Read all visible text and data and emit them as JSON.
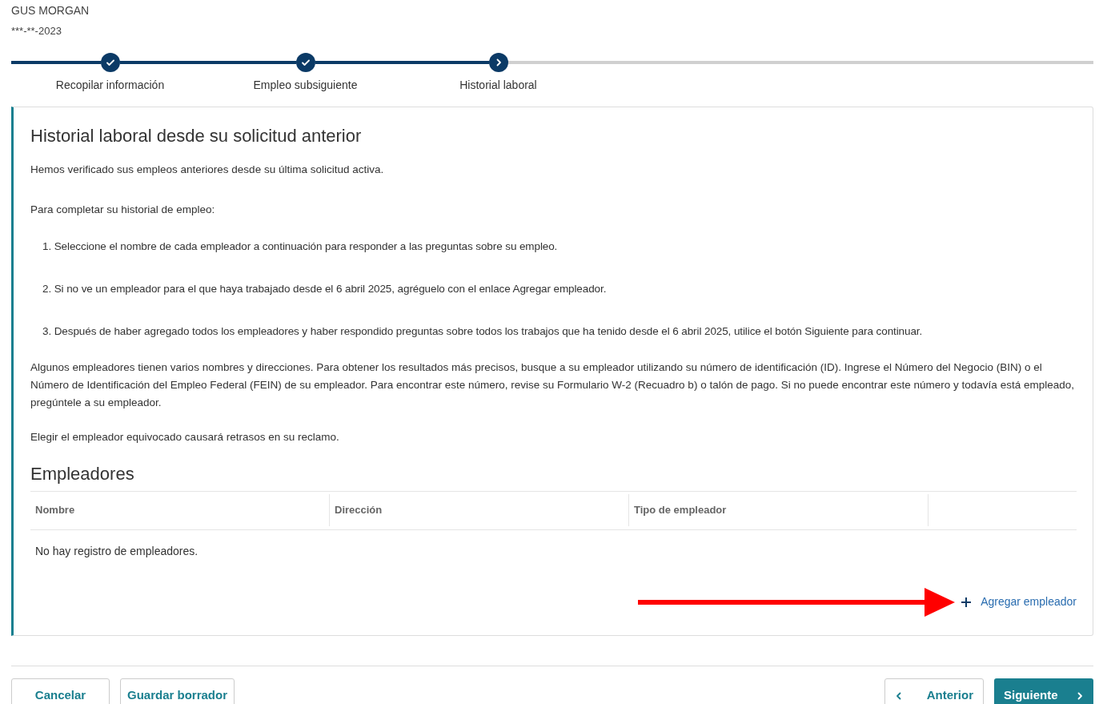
{
  "header": {
    "name": "GUS MORGAN",
    "masked_id": "***-**-2023"
  },
  "steps": [
    {
      "label": "Recopilar información",
      "completed": true,
      "selected": false
    },
    {
      "label": "Empleo subsiguiente",
      "completed": true,
      "selected": false
    },
    {
      "label": "Historial laboral",
      "completed": false,
      "selected": true
    }
  ],
  "card": {
    "title": "Historial laboral desde su solicitud anterior",
    "intro": "Hemos verificado sus empleos anteriores desde su última solicitud activa.",
    "list_heading": "Para completar su historial de empleo:",
    "instructions": [
      "1. Seleccione el nombre de cada empleador a continuación para responder a las preguntas sobre su empleo.",
      "2. Si no ve un empleador para el que haya trabajado desde el 6 abril 2025, agréguelo con el enlace Agregar empleador.",
      "3. Después de haber agregado todos los empleadores y haber respondido preguntas sobre todos los trabajos que ha tenido desde el 6 abril 2025, utilice el botón Siguiente para continuar."
    ],
    "note": "Algunos empleadores tienen varios nombres y direcciones. Para obtener los resultados más precisos, busque a su empleador utilizando su número de identificación (ID). Ingrese el Número del Negocio (BIN) o el Número de Identificación del Empleo Federal (FEIN) de su empleador. Para encontrar este número, revise su Formulario W-2 (Recuadro b) o talón de pago.  Si no puede encontrar este número y todavía está empleado, pregúntele a su empleador.",
    "warning": "Elegir el empleador equivocado causará retrasos en su reclamo.",
    "employers": {
      "title": "Empleadores",
      "columns": [
        "Nombre",
        "Dirección",
        "Tipo de empleador"
      ],
      "empty_message": "No hay registro de empleadores.",
      "add_link": "Agregar empleador"
    }
  },
  "footer": {
    "left_buttons": [
      "Cancelar",
      "Guardar borrador"
    ],
    "previous": "Anterior",
    "next": "Siguiente"
  }
}
